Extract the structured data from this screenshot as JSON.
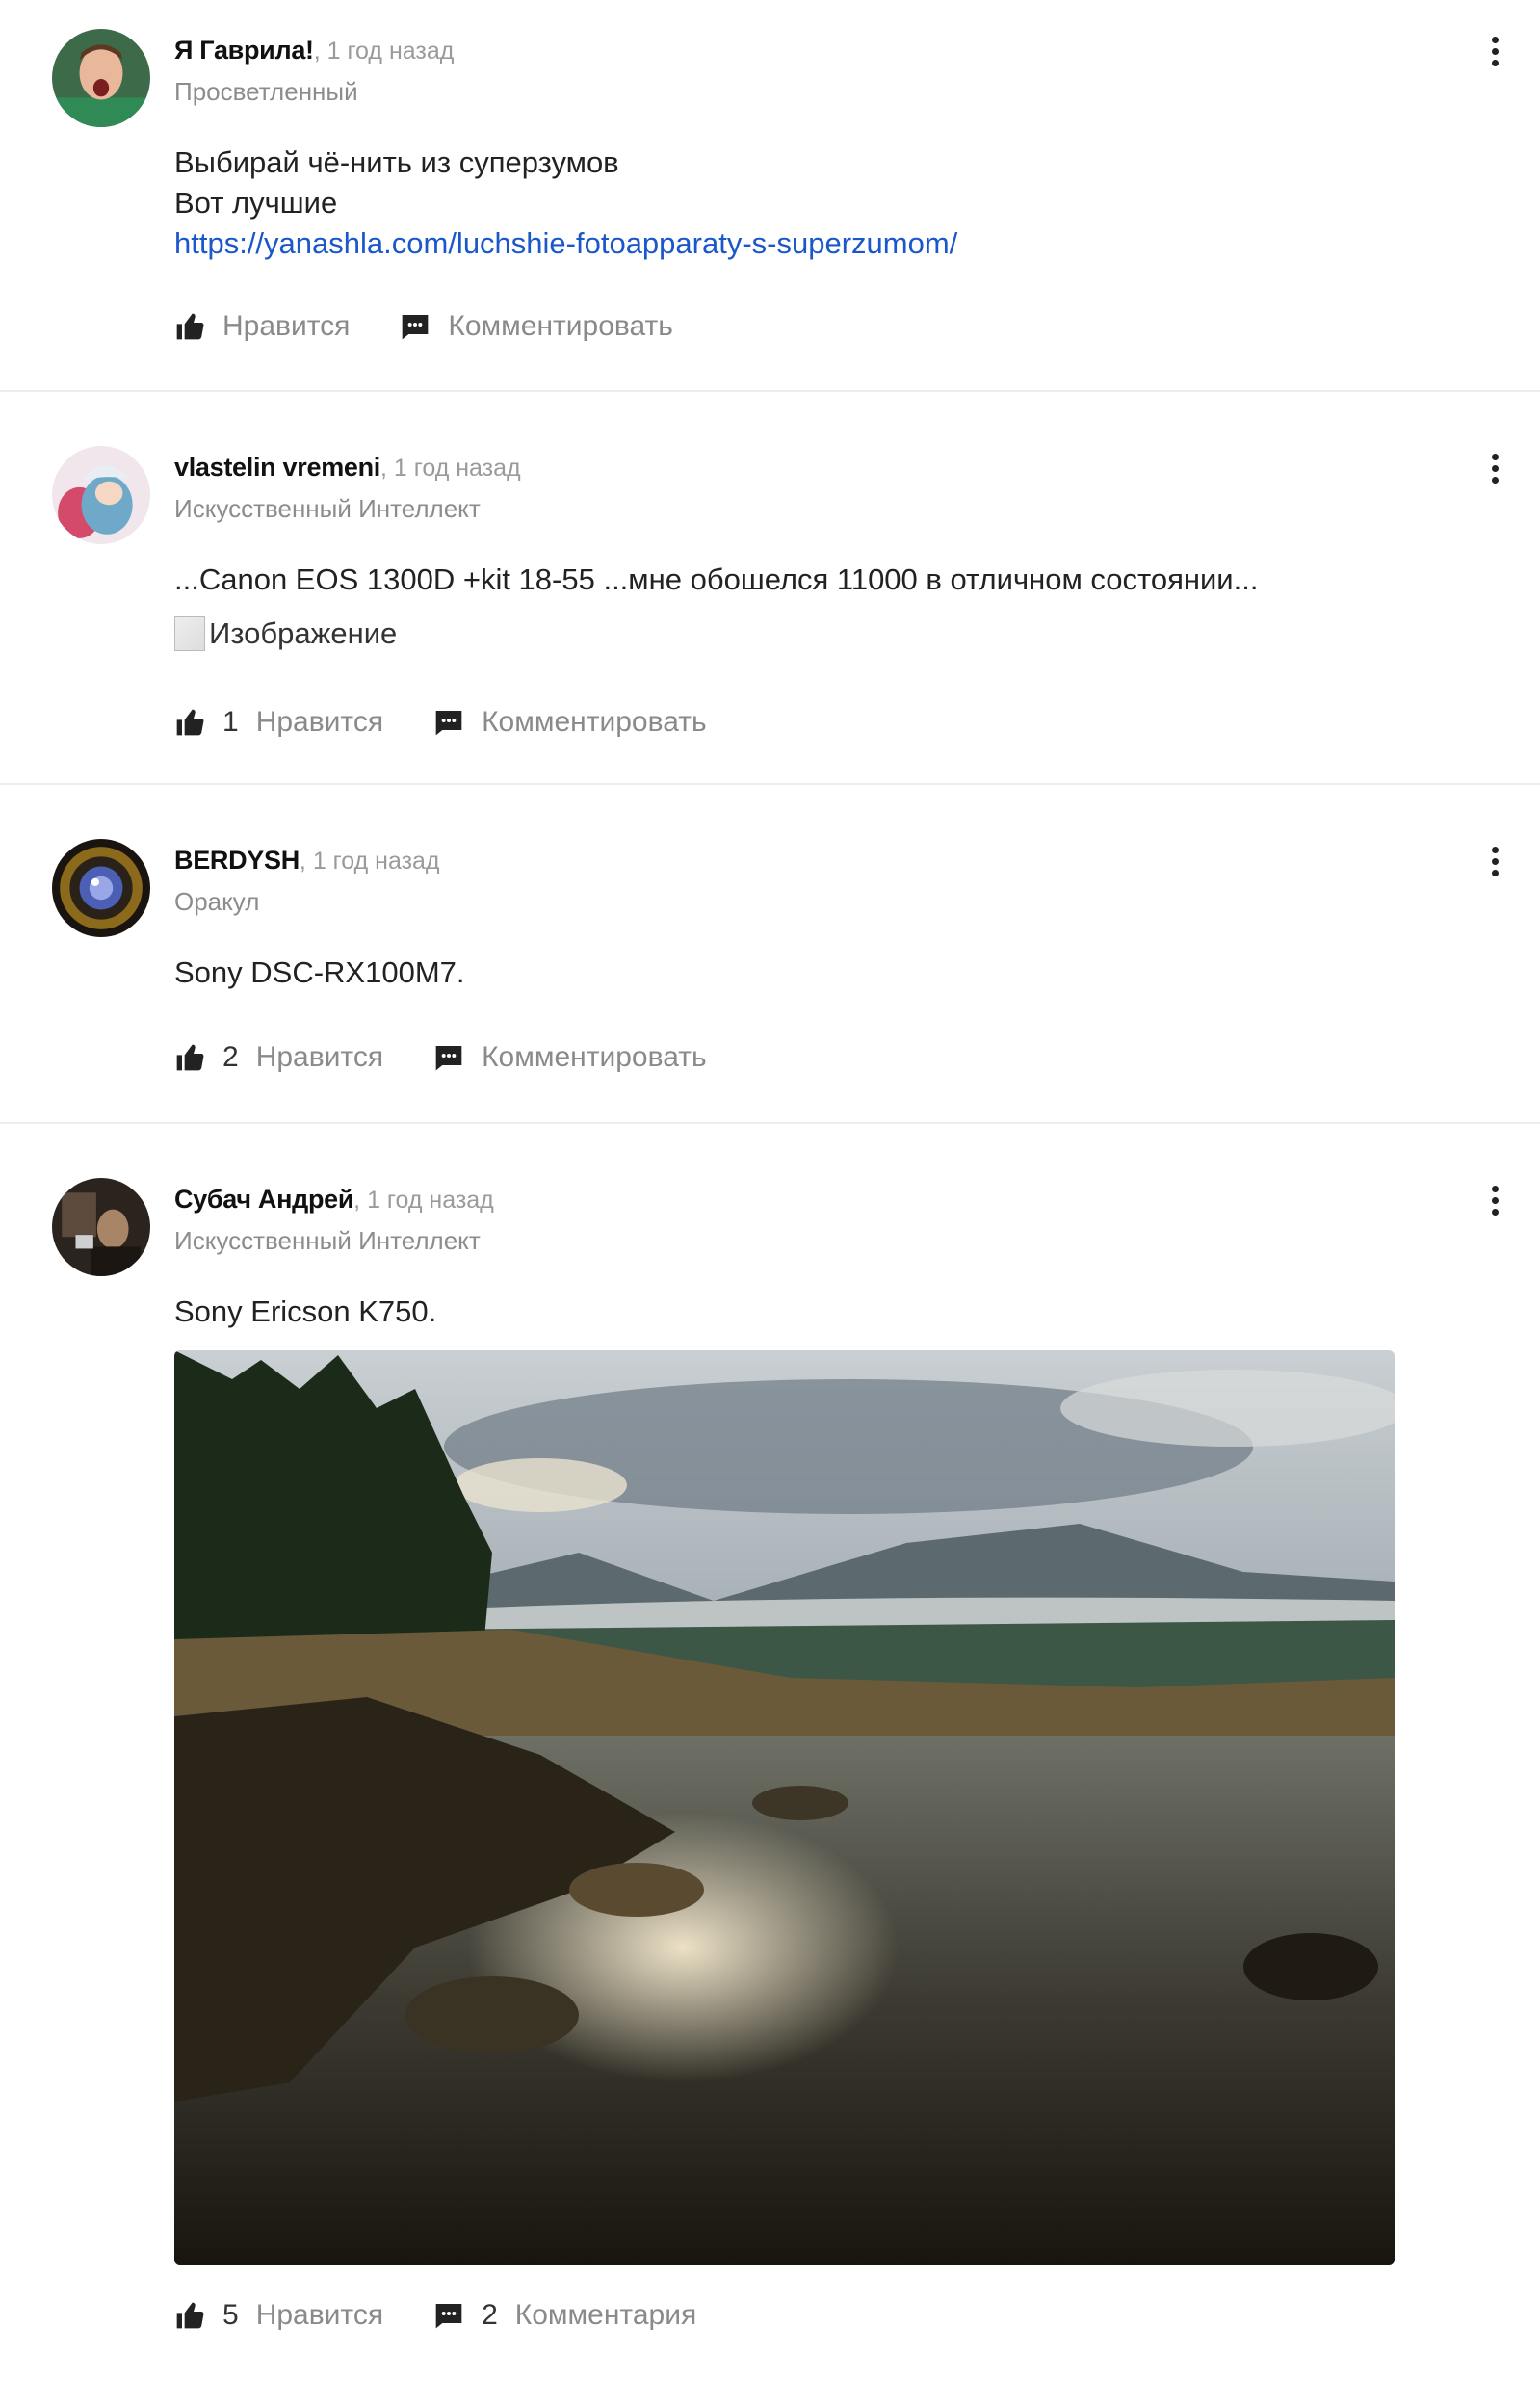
{
  "posts": [
    {
      "author": "Я Гаврила!",
      "time": "1 год назад",
      "rank": "Просветленный",
      "lines": [
        "Выбирай чё-нить из суперзумов",
        "Вот лучшие"
      ],
      "link": "https://yanashla.com/luchshie-fotoapparaty-s-superzumom/",
      "like_label": "Нравится",
      "comment_label": "Комментировать"
    },
    {
      "author": "vlastelin vremeni",
      "time": "1 год назад",
      "rank": "Искусственный Интеллект",
      "text": "...Canon EOS 1300D +kit 18-55 ...мне обошелся 11000 в отличном состоянии...",
      "image_alt": "Изображение",
      "likes": "1",
      "like_label": "Нравится",
      "comment_label": "Комментировать"
    },
    {
      "author": "BERDYSH",
      "time": "1 год назад",
      "rank": "Оракул",
      "text": "Sony DSC-RX100M7.",
      "likes": "2",
      "like_label": "Нравится",
      "comment_label": "Комментировать"
    },
    {
      "author": "Субач Андрей",
      "time": "1 год назад",
      "rank": "Искусственный Интеллект",
      "text": "Sony Ericson K750.",
      "likes": "5",
      "like_label": "Нравится",
      "comments": "2",
      "comment_label": "Комментария"
    }
  ],
  "icons": {
    "like": "thumbs-up-icon",
    "comment": "comment-icon",
    "menu": "kebab-menu-icon"
  },
  "colors": {
    "link": "#1a57c8",
    "muted": "#8c8c8c",
    "divider": "#ececec"
  }
}
